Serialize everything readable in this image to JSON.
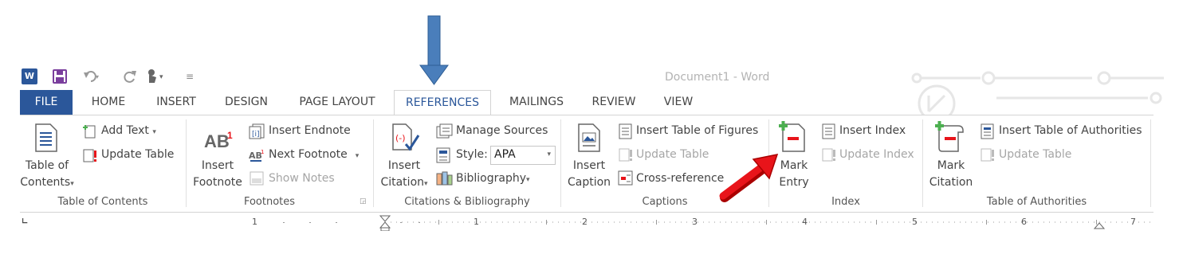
{
  "window": {
    "title": "Document1 - Word"
  },
  "tabs": [
    "FILE",
    "HOME",
    "INSERT",
    "DESIGN",
    "PAGE LAYOUT",
    "REFERENCES",
    "MAILINGS",
    "REVIEW",
    "VIEW"
  ],
  "groups": {
    "toc": {
      "label": "Table of Contents",
      "big_line1": "Table of",
      "big_line2": "Contents",
      "add_text": "Add Text",
      "update_table": "Update Table"
    },
    "footnotes": {
      "label": "Footnotes",
      "big_line1": "Insert",
      "big_line2": "Footnote",
      "insert_endnote": "Insert Endnote",
      "next_footnote": "Next Footnote",
      "show_notes": "Show Notes"
    },
    "citations": {
      "label": "Citations & Bibliography",
      "big_line1": "Insert",
      "big_line2": "Citation",
      "manage_sources": "Manage Sources",
      "style_label": "Style:",
      "style_value": "APA",
      "bibliography": "Bibliography"
    },
    "captions": {
      "label": "Captions",
      "big_line1": "Insert",
      "big_line2": "Caption",
      "insert_table_of_figures": "Insert Table of Figures",
      "update_table": "Update Table",
      "cross_reference": "Cross-reference"
    },
    "index": {
      "label": "Index",
      "big_line1": "Mark",
      "big_line2": "Entry",
      "insert_index": "Insert Index",
      "update_index": "Update Index"
    },
    "authorities": {
      "label": "Table of Authorities",
      "big_line1": "Mark",
      "big_line2": "Citation",
      "insert_toa": "Insert Table of Authorities",
      "update_table": "Update Table"
    }
  },
  "ruler": {
    "numbers": [
      "1",
      "1",
      "2",
      "3",
      "4",
      "5",
      "6",
      "7"
    ]
  },
  "colors": {
    "accent": "#2b579a",
    "arrow_blue": "#4a7ebb",
    "arrow_red": "#e8141a"
  }
}
